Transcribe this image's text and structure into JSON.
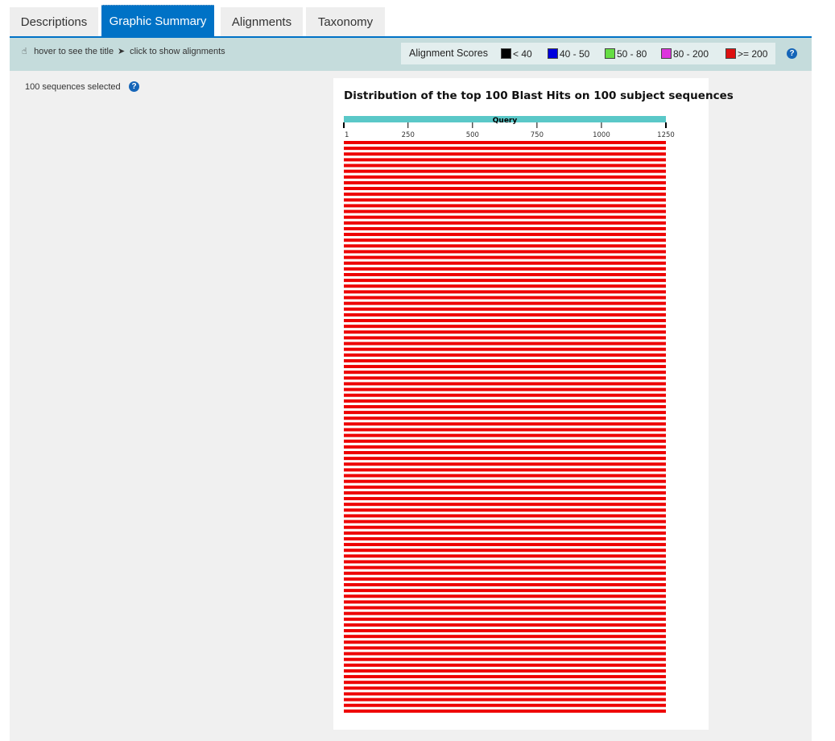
{
  "tabs": [
    {
      "label": "Descriptions",
      "active": false
    },
    {
      "label": "Graphic Summary",
      "active": true
    },
    {
      "label": "Alignments",
      "active": false
    },
    {
      "label": "Taxonomy",
      "active": false
    }
  ],
  "toolbar": {
    "hover_hint": "hover to see the title",
    "click_hint": "click to show alignments",
    "legend_title": "Alignment Scores",
    "legend": [
      {
        "label": "< 40",
        "color": "#000000"
      },
      {
        "label": "40 - 50",
        "color": "#0000dd"
      },
      {
        "label": "50 - 80",
        "color": "#66dd44"
      },
      {
        "label": "80 - 200",
        "color": "#dd33dd"
      },
      {
        "label": ">= 200",
        "color": "#dd1111"
      }
    ]
  },
  "sidebar": {
    "selected_text": "100 sequences selected"
  },
  "graphic": {
    "title": "Distribution of the top 100 Blast Hits on 100 subject sequences",
    "query_label": "Query",
    "query_color": "#5ac8c8",
    "hit_color": "#ee0000",
    "axis_max": 1250,
    "ticks": [
      1,
      250,
      500,
      750,
      1000,
      1250
    ],
    "hit_count": 100,
    "hit_start": 1,
    "hit_end": 1250
  }
}
